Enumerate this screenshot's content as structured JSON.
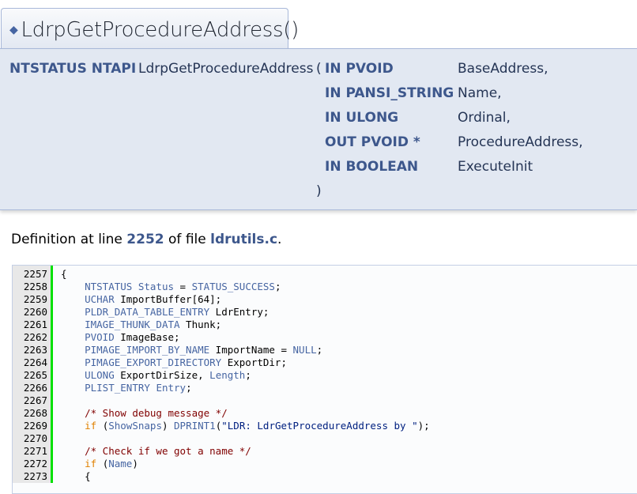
{
  "title": "LdrpGetProcedureAddress()",
  "prototype": {
    "return": "NTSTATUS NTAPI",
    "name": "LdrpGetProcedureAddress",
    "open": "(",
    "close": ")",
    "params": [
      {
        "type": "IN PVOID",
        "name": "BaseAddress,"
      },
      {
        "type": "IN PANSI_STRING",
        "name": "Name,"
      },
      {
        "type": "IN ULONG",
        "name": "Ordinal,"
      },
      {
        "type": "OUT PVOID *",
        "name": "ProcedureAddress,"
      },
      {
        "type": "IN BOOLEAN",
        "name": "ExecuteInit"
      }
    ]
  },
  "definition": {
    "prefix": "Definition at line",
    "line": "2252",
    "middle": "of file",
    "file": "ldrutils.c",
    "suffix": "."
  },
  "code": [
    {
      "n": "2257",
      "parts": [
        [
          "",
          "{"
        ]
      ]
    },
    {
      "n": "2258",
      "parts": [
        [
          "",
          "    "
        ],
        [
          "ty",
          "NTSTATUS"
        ],
        [
          "",
          " "
        ],
        [
          "ty",
          "Status"
        ],
        [
          "",
          " = "
        ],
        [
          "ty",
          "STATUS_SUCCESS"
        ],
        [
          "",
          ";"
        ]
      ]
    },
    {
      "n": "2259",
      "parts": [
        [
          "",
          "    "
        ],
        [
          "ty",
          "UCHAR"
        ],
        [
          "",
          " ImportBuffer[64];"
        ]
      ]
    },
    {
      "n": "2260",
      "parts": [
        [
          "",
          "    "
        ],
        [
          "ty",
          "PLDR_DATA_TABLE_ENTRY"
        ],
        [
          "",
          " LdrEntry;"
        ]
      ]
    },
    {
      "n": "2261",
      "parts": [
        [
          "",
          "    "
        ],
        [
          "ty",
          "IMAGE_THUNK_DATA"
        ],
        [
          "",
          " Thunk;"
        ]
      ]
    },
    {
      "n": "2262",
      "parts": [
        [
          "",
          "    "
        ],
        [
          "ty",
          "PVOID"
        ],
        [
          "",
          " ImageBase;"
        ]
      ]
    },
    {
      "n": "2263",
      "parts": [
        [
          "",
          "    "
        ],
        [
          "ty",
          "PIMAGE_IMPORT_BY_NAME"
        ],
        [
          "",
          " ImportName = "
        ],
        [
          "ty",
          "NULL"
        ],
        [
          "",
          ";"
        ]
      ]
    },
    {
      "n": "2264",
      "parts": [
        [
          "",
          "    "
        ],
        [
          "ty",
          "PIMAGE_EXPORT_DIRECTORY"
        ],
        [
          "",
          " ExportDir;"
        ]
      ]
    },
    {
      "n": "2265",
      "parts": [
        [
          "",
          "    "
        ],
        [
          "ty",
          "ULONG"
        ],
        [
          "",
          " ExportDirSize, "
        ],
        [
          "ty",
          "Length"
        ],
        [
          "",
          ";"
        ]
      ]
    },
    {
      "n": "2266",
      "parts": [
        [
          "",
          "    "
        ],
        [
          "ty",
          "PLIST_ENTRY"
        ],
        [
          "",
          " "
        ],
        [
          "ty",
          "Entry"
        ],
        [
          "",
          ";"
        ]
      ]
    },
    {
      "n": "2267",
      "parts": []
    },
    {
      "n": "2268",
      "parts": [
        [
          "",
          "    "
        ],
        [
          "cm",
          "/* Show debug message */"
        ]
      ]
    },
    {
      "n": "2269",
      "parts": [
        [
          "",
          "    "
        ],
        [
          "kw",
          "if"
        ],
        [
          "",
          " ("
        ],
        [
          "ty",
          "ShowSnaps"
        ],
        [
          "",
          ") "
        ],
        [
          "ty",
          "DPRINT1"
        ],
        [
          "",
          "("
        ],
        [
          "st",
          "\"LDR: LdrGetProcedureAddress by \""
        ],
        [
          "",
          ");"
        ]
      ]
    },
    {
      "n": "2270",
      "parts": []
    },
    {
      "n": "2271",
      "parts": [
        [
          "",
          "    "
        ],
        [
          "cm",
          "/* Check if we got a name */"
        ]
      ]
    },
    {
      "n": "2272",
      "parts": [
        [
          "",
          "    "
        ],
        [
          "kw",
          "if"
        ],
        [
          "",
          " ("
        ],
        [
          "ty",
          "Name"
        ],
        [
          "",
          ")"
        ]
      ]
    },
    {
      "n": "2273",
      "parts": [
        [
          "",
          "    {"
        ]
      ]
    }
  ]
}
